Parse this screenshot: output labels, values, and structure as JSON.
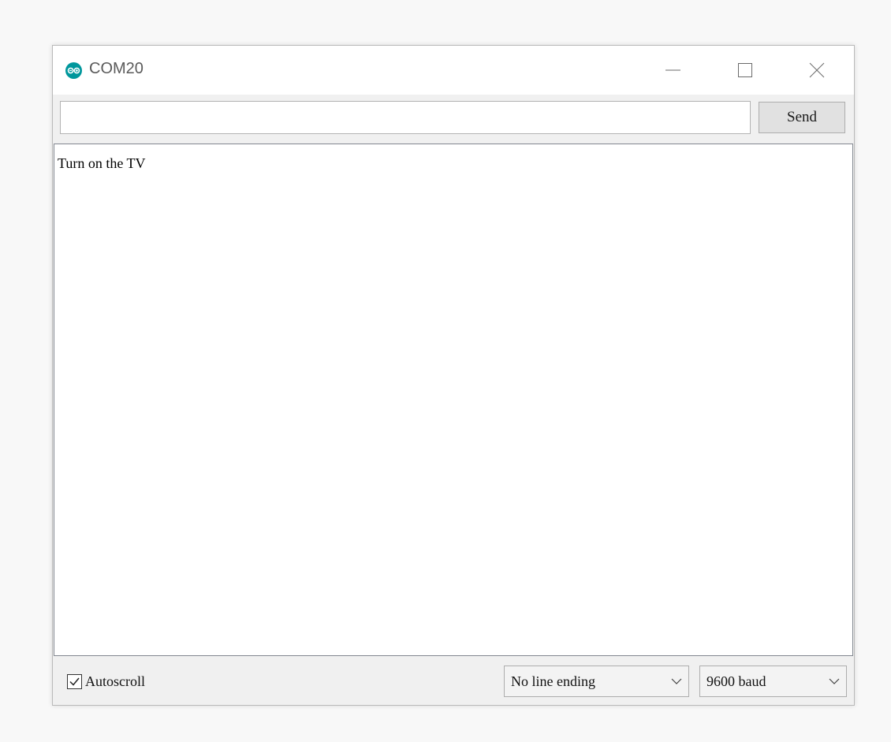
{
  "window": {
    "title": "COM20",
    "app_icon": "arduino-logo-icon",
    "controls": {
      "minimize_icon": "minimize-icon",
      "maximize_icon": "maximize-icon",
      "close_icon": "close-icon"
    }
  },
  "send_bar": {
    "input_value": "",
    "send_label": "Send"
  },
  "output": {
    "lines": [
      "Turn on the TV"
    ]
  },
  "footer": {
    "autoscroll_label": "Autoscroll",
    "autoscroll_checked": true,
    "line_ending": "No line ending",
    "baud_rate": "9600 baud"
  },
  "colors": {
    "arduino_teal": "#00979C",
    "window_bg": "#f0f0f0",
    "output_bg": "#ffffff"
  }
}
